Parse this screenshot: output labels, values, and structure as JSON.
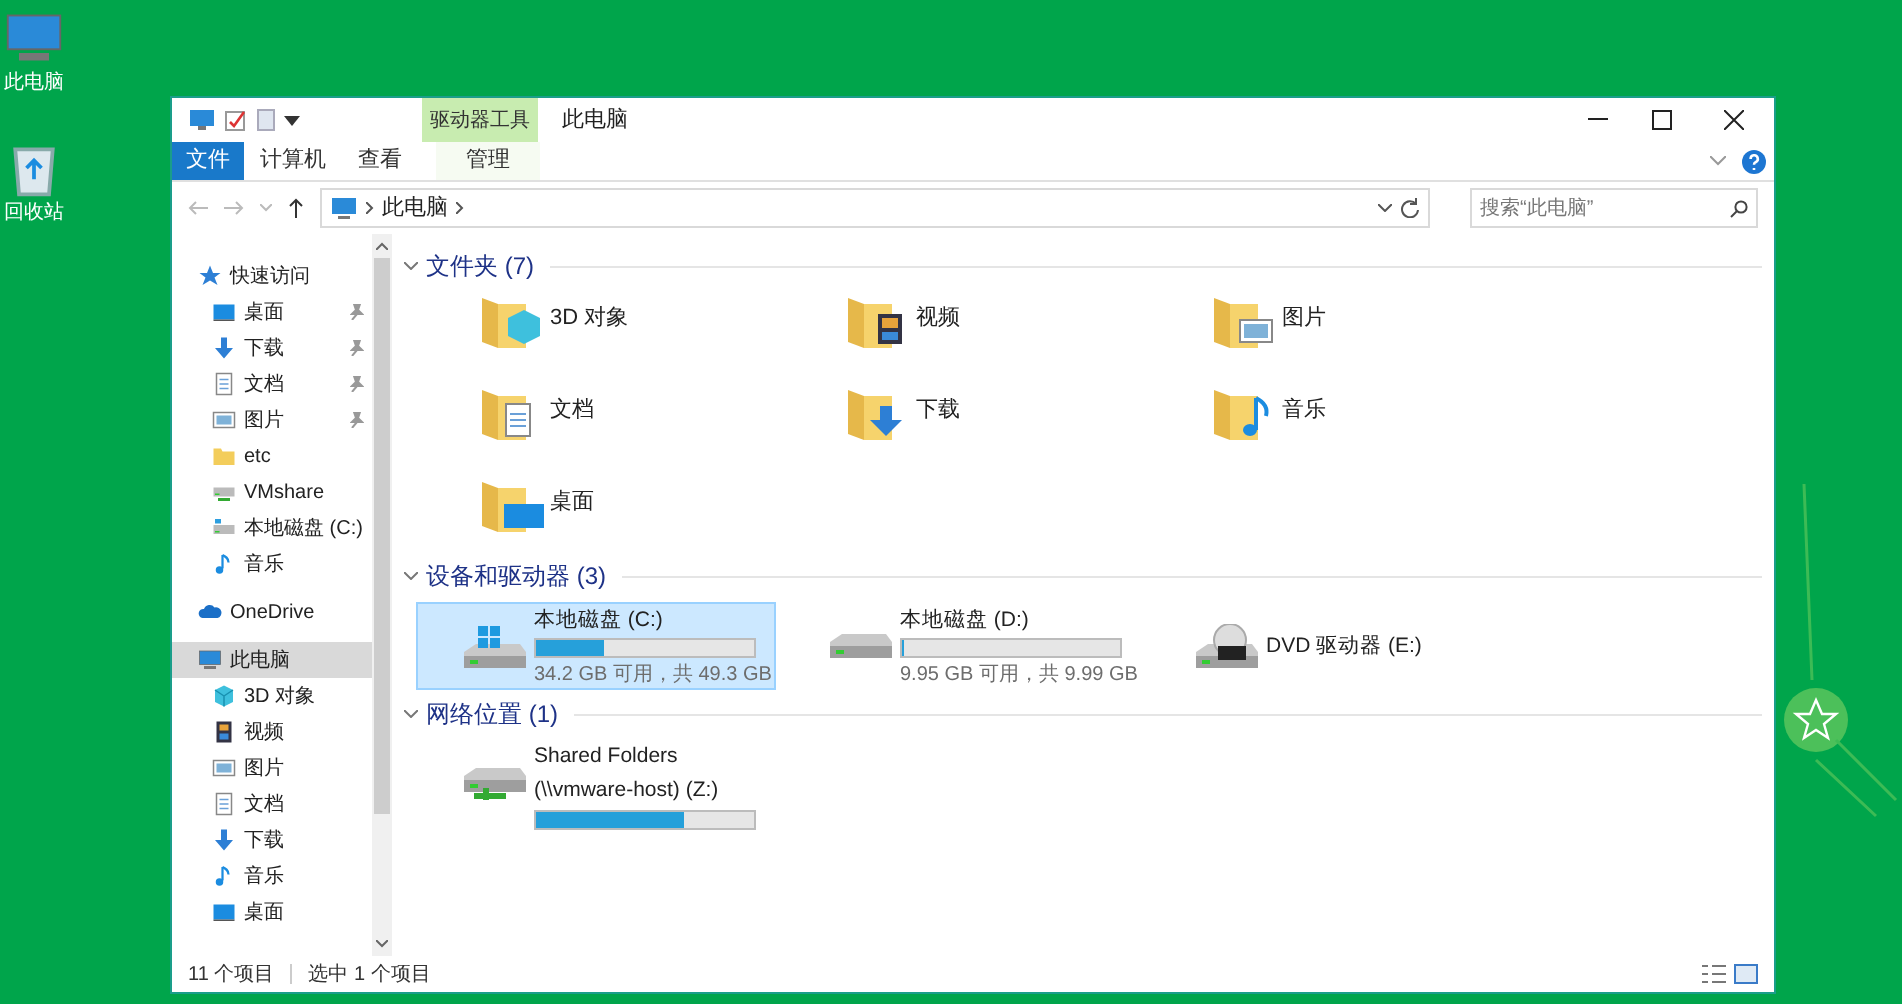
{
  "desktop_icons": [
    {
      "kind": "computer",
      "label": "此电脑"
    },
    {
      "kind": "recycle-bin",
      "label": "回收站"
    }
  ],
  "window": {
    "title": "此电脑",
    "ribbon_group": "驱动器工具",
    "ribbon_tabs": [
      {
        "kind": "file",
        "label": "文件",
        "selected": false
      },
      {
        "kind": "normal",
        "label": "计算机",
        "selected": false
      },
      {
        "kind": "normal",
        "label": "查看",
        "selected": false
      },
      {
        "kind": "contextual",
        "label": "管理",
        "selected": false
      }
    ]
  },
  "address_bar": {
    "path": [
      "此电脑"
    ]
  },
  "search": {
    "placeholder": "搜索“此电脑”"
  },
  "sidebar": {
    "items": [
      {
        "kind": "star",
        "label": "快速访问",
        "selected": false,
        "pinned": false,
        "children": [
          {
            "kind": "desktop",
            "label": "桌面",
            "selected": false,
            "pinned": true
          },
          {
            "kind": "download",
            "label": "下载",
            "selected": false,
            "pinned": true
          },
          {
            "kind": "document",
            "label": "文档",
            "selected": false,
            "pinned": true
          },
          {
            "kind": "picture",
            "label": "图片",
            "selected": false,
            "pinned": true
          },
          {
            "kind": "folder",
            "label": "etc",
            "selected": false,
            "pinned": false
          },
          {
            "kind": "share",
            "label": "VMshare",
            "selected": false,
            "pinned": false
          },
          {
            "kind": "drive",
            "label": "本地磁盘 (C:)",
            "selected": false,
            "pinned": false
          },
          {
            "kind": "music",
            "label": "音乐",
            "selected": false,
            "pinned": false
          }
        ]
      },
      {
        "kind": "cloud",
        "label": "OneDrive",
        "selected": false,
        "pinned": false
      },
      {
        "kind": "computer",
        "label": "此电脑",
        "selected": true,
        "pinned": false,
        "children": [
          {
            "kind": "cube",
            "label": "3D 对象",
            "selected": false,
            "pinned": false
          },
          {
            "kind": "video",
            "label": "视频",
            "selected": false,
            "pinned": false
          },
          {
            "kind": "picture",
            "label": "图片",
            "selected": false,
            "pinned": false
          },
          {
            "kind": "document",
            "label": "文档",
            "selected": false,
            "pinned": false
          },
          {
            "kind": "download",
            "label": "下载",
            "selected": false,
            "pinned": false
          },
          {
            "kind": "music",
            "label": "音乐",
            "selected": false,
            "pinned": false
          },
          {
            "kind": "desktop",
            "label": "桌面",
            "selected": false,
            "pinned": false
          }
        ]
      }
    ]
  },
  "sections": [
    {
      "kind": "folders",
      "title": "文件夹 (7)",
      "items": [
        {
          "kind": "cube",
          "name": "3D 对象"
        },
        {
          "kind": "video",
          "name": "视频"
        },
        {
          "kind": "picture",
          "name": "图片"
        },
        {
          "kind": "document",
          "name": "文档"
        },
        {
          "kind": "download",
          "name": "下载"
        },
        {
          "kind": "music",
          "name": "音乐"
        },
        {
          "kind": "desktop",
          "name": "桌面"
        }
      ]
    },
    {
      "kind": "drives",
      "title": "设备和驱动器 (3)",
      "items": [
        {
          "kind": "system",
          "name": "本地磁盘 (C:)",
          "level": 0.31,
          "reading": "34.2 GB 可用，共 49.3 GB",
          "selected": true
        },
        {
          "kind": "drive",
          "name": "本地磁盘 (D:)",
          "level": 0.004,
          "reading": "9.95 GB 可用，共 9.99 GB",
          "selected": false
        },
        {
          "kind": "dvd",
          "name": "DVD 驱动器 (E:)",
          "selected": false
        }
      ]
    },
    {
      "kind": "network",
      "title": "网络位置 (1)",
      "items": [
        {
          "kind": "network",
          "name": "Shared Folders",
          "name_2": "(\\\\vmware-host) (Z:)",
          "level": 0.68,
          "selected": false
        }
      ]
    }
  ],
  "status_bar": {
    "item_count": "11 个项目",
    "selection": "选中 1 个项目"
  }
}
